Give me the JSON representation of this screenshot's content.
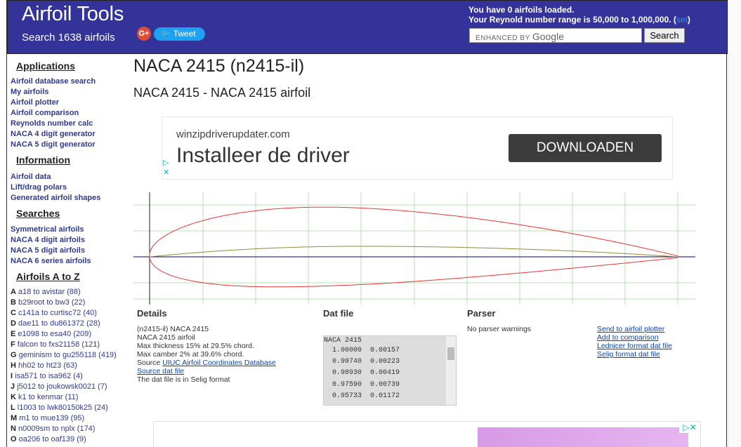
{
  "header": {
    "title": "Airfoil Tools",
    "subtitle": "Search 1638 airfoils",
    "gplus_label": "G+",
    "tweet_label": "Tweet",
    "loaded_line1": "You have 0 airfoils loaded.",
    "loaded_line2": "Your Reynold number range is 50,000 to 1,000,000. (",
    "set_link": "set",
    "loaded_close": ")",
    "search_prefix": "ENHANCED BY",
    "search_google": "Google",
    "search_button": "Search",
    "colors": {
      "header_bg": "#33339a"
    }
  },
  "sidebar": {
    "applications_head": "Applications",
    "applications": [
      "Airfoil database search",
      "My airfoils",
      "Airfoil plotter",
      "Airfoil comparison",
      "Reynolds number calc",
      "NACA 4 digit generator",
      "NACA 5 digit generator"
    ],
    "information_head": "Information",
    "information": [
      "Airfoil data",
      "Lift/drag polars",
      "Generated airfoil shapes"
    ],
    "searches_head": "Searches",
    "searches": [
      "Symmetrical airfoils",
      "NACA 4 digit airfoils",
      "NACA 5 digit airfoils",
      "NACA 6 series airfoils"
    ],
    "az_head": "Airfoils A to Z",
    "az": [
      {
        "letter": "A",
        "text": "a18 to avistar (88)"
      },
      {
        "letter": "B",
        "text": "b29root to bw3 (22)"
      },
      {
        "letter": "C",
        "text": "c141a to curtisc72 (40)"
      },
      {
        "letter": "D",
        "text": "dae11 to du861372 (28)"
      },
      {
        "letter": "E",
        "text": "e1098 to esa40 (209)"
      },
      {
        "letter": "F",
        "text": "falcon to fxs21158 (121)"
      },
      {
        "letter": "G",
        "text": "geminism to gu255118 (419)"
      },
      {
        "letter": "H",
        "text": "hh02 to ht23 (63)"
      },
      {
        "letter": "I",
        "text": "isa571 to isa962 (4)"
      },
      {
        "letter": "J",
        "text": "j5012 to joukowsk0021 (7)"
      },
      {
        "letter": "K",
        "text": "k1 to kenmar (11)"
      },
      {
        "letter": "L",
        "text": "l1003 to lwk80150k25 (24)"
      },
      {
        "letter": "M",
        "text": "m1 to mue139 (95)"
      },
      {
        "letter": "N",
        "text": "n0009sm to nplx (174)"
      },
      {
        "letter": "O",
        "text": "oa206 to oaf139 (9)"
      }
    ]
  },
  "main": {
    "title": "NACA 2415 (n2415-il)",
    "subtitle": "NACA 2415 - NACA 2415 airfoil",
    "ad": {
      "domain": "winzipdriverupdater.com",
      "headline": "Installeer de driver",
      "button": "DOWNLOADEN"
    },
    "details": {
      "head": "Details",
      "lines": [
        "(n2415-il) NACA 2415",
        "NACA 2415 airfoil",
        "Max thickness 15% at 29.5% chord.",
        "Max camber 2% at 39.6% chord."
      ],
      "source_prefix": "Source ",
      "source_link": "UIUC Airfoil Coordinates Database",
      "source_dat": "Source dat file",
      "format_note": "The dat file is in Selig format"
    },
    "dat_file": {
      "head": "Dat file",
      "header_line": "NACA 2415",
      "rows": [
        " 1.00000  0.00157",
        " 0.99740  0.00223",
        " 0.98930  0.00419",
        " 0.97590  0.00739",
        " 0.95733  0.01172"
      ]
    },
    "parser": {
      "head": "Parser",
      "message": "No parser warnings",
      "links": [
        "Send to airfoil plotter",
        "Add to comparison",
        "Lednicer format dat file",
        "Selig format dat file"
      ]
    },
    "airfoil_profile": {
      "max_thickness": 0.15,
      "max_thickness_x": 0.295,
      "max_camber": 0.02,
      "max_camber_x": 0.396
    }
  }
}
